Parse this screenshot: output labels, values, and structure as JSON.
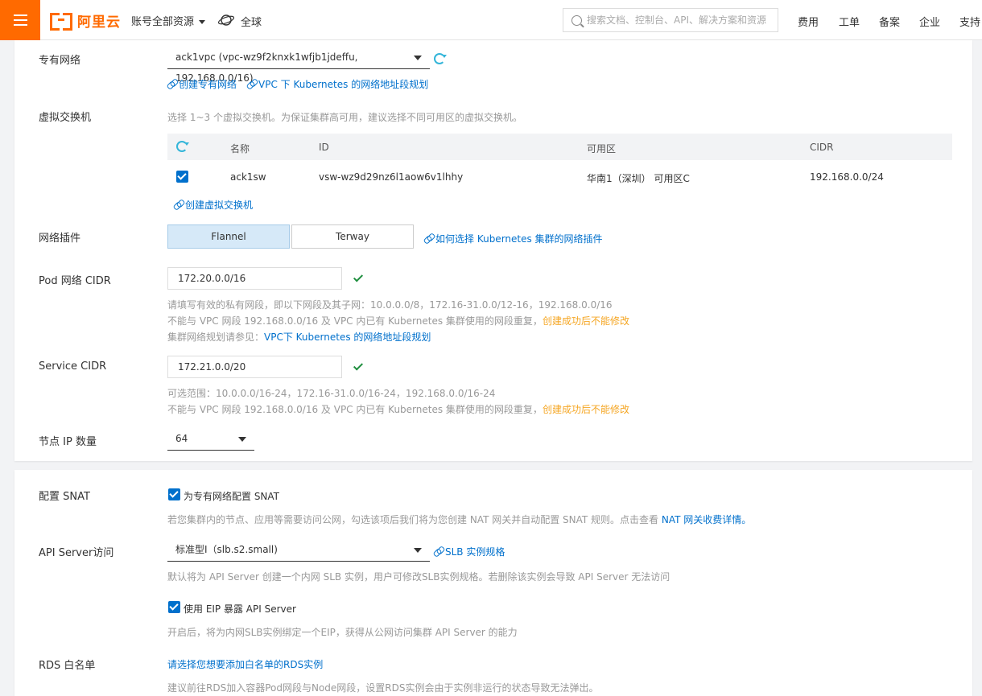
{
  "header": {
    "logo_text": "阿里云",
    "account": "账号全部资源",
    "region": "全球",
    "search_placeholder": "搜索文档、控制台、API、解决方案和资源",
    "nav": [
      "费用",
      "工单",
      "备案",
      "企业",
      "支持"
    ]
  },
  "network": {
    "vpc_label": "专有网络",
    "vpc_value": "ack1vpc (vpc-wz9f2knxk1wfjb1jdeffu, 192.168.0.0/16)",
    "vpc_link_create": "创建专有网络",
    "vpc_link_plan": "VPC 下 Kubernetes 的网络地址段规划",
    "vswitch_label": "虚拟交换机",
    "vswitch_hint": "选择 1~3 个虚拟交换机。为保证集群高可用，建议选择不同可用区的虚拟交换机。",
    "table": {
      "headers": [
        "名称",
        "ID",
        "可用区",
        "CIDR"
      ],
      "row": {
        "name": "ack1sw",
        "id": "vsw-wz9d29nz6l1aow6v1lhhy",
        "zone": "华南1（深圳） 可用区C",
        "cidr": "192.168.0.0/24"
      }
    },
    "vswitch_link_create": "创建虚拟交换机",
    "plugin_label": "网络插件",
    "plugin_options": [
      "Flannel",
      "Terway"
    ],
    "plugin_link": "如何选择 Kubernetes 集群的网络插件",
    "pod_label": "Pod 网络 CIDR",
    "pod_value": "172.20.0.0/16",
    "pod_hint1": "请填写有效的私有网段，即以下网段及其子网：10.0.0.0/8，172.16-31.0.0/12-16，192.168.0.0/16",
    "pod_hint2": "不能与 VPC 网段 192.168.0.0/16 及 VPC 内已有 Kubernetes 集群使用的网段重复，",
    "pod_hint2_warn": "创建成功后不能修改",
    "pod_hint3": "集群网络规划请参见：",
    "pod_hint3_link": "VPC下 Kubernetes 的网络地址段规划",
    "service_label": "Service CIDR",
    "service_value": "172.21.0.0/20",
    "service_hint1": "可选范围：10.0.0.0/16-24，172.16-31.0.0/16-24，192.168.0.0/16-24",
    "service_hint2": "不能与 VPC 网段 192.168.0.0/16 及 VPC 内已有 Kubernetes 集群使用的网段重复，",
    "service_hint2_warn": "创建成功后不能修改",
    "node_ip_label": "节点 IP 数量",
    "node_ip_value": "64"
  },
  "access": {
    "snat_label": "配置 SNAT",
    "snat_checkbox": "为专有网络配置 SNAT",
    "snat_hint": "若您集群内的节点、应用等需要访问公网，勾选该项后我们将为您创建 NAT 网关并自动配置 SNAT 规则。点击查看 ",
    "snat_hint_link": "NAT 网关收费详情。",
    "api_label": "API Server访问",
    "api_value": "标准型I（slb.s2.small)",
    "api_link": "SLB 实例规格",
    "api_hint": "默认将为 API Server 创建一个内网 SLB 实例，用户可修改SLB实例规格。若删除该实例会导致 API Server 无法访问",
    "eip_checkbox": "使用 EIP 暴露 API Server",
    "eip_hint": "开启后，将为内网SLB实例绑定一个EIP，获得从公网访问集群 API Server 的能力",
    "rds_label": "RDS 白名单",
    "rds_link": "请选择您想要添加白名单的RDS实例",
    "rds_hint": "建议前往RDS加入容器Pod网段与Node网段，设置RDS实例会由于实例非运行的状态导致无法弹出。"
  }
}
